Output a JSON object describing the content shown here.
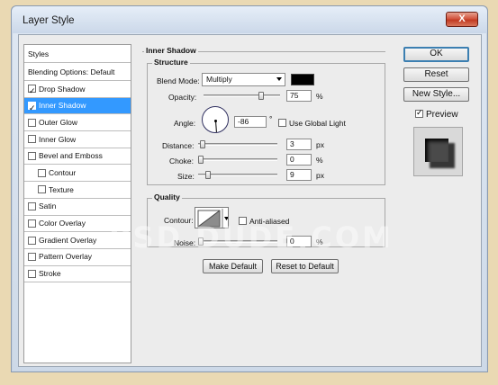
{
  "window": {
    "title": "Layer Style",
    "close_label": "X"
  },
  "styles_list": {
    "header": "Styles",
    "items": [
      {
        "label": "Blending Options: Default",
        "checkbox": false,
        "checked": false,
        "selected": false,
        "indent": false
      },
      {
        "label": "Drop Shadow",
        "checkbox": true,
        "checked": true,
        "selected": false,
        "indent": false
      },
      {
        "label": "Inner Shadow",
        "checkbox": true,
        "checked": true,
        "selected": true,
        "indent": false
      },
      {
        "label": "Outer Glow",
        "checkbox": true,
        "checked": false,
        "selected": false,
        "indent": false
      },
      {
        "label": "Inner Glow",
        "checkbox": true,
        "checked": false,
        "selected": false,
        "indent": false
      },
      {
        "label": "Bevel and Emboss",
        "checkbox": true,
        "checked": false,
        "selected": false,
        "indent": false
      },
      {
        "label": "Contour",
        "checkbox": true,
        "checked": false,
        "selected": false,
        "indent": true
      },
      {
        "label": "Texture",
        "checkbox": true,
        "checked": false,
        "selected": false,
        "indent": true
      },
      {
        "label": "Satin",
        "checkbox": true,
        "checked": false,
        "selected": false,
        "indent": false
      },
      {
        "label": "Color Overlay",
        "checkbox": true,
        "checked": false,
        "selected": false,
        "indent": false
      },
      {
        "label": "Gradient Overlay",
        "checkbox": true,
        "checked": false,
        "selected": false,
        "indent": false
      },
      {
        "label": "Pattern Overlay",
        "checkbox": true,
        "checked": false,
        "selected": false,
        "indent": false
      },
      {
        "label": "Stroke",
        "checkbox": true,
        "checked": false,
        "selected": false,
        "indent": false
      }
    ]
  },
  "inner_shadow": {
    "title": "Inner Shadow",
    "structure": {
      "title": "Structure",
      "blend_mode_label": "Blend Mode:",
      "blend_mode_value": "Multiply",
      "color": "#000000",
      "opacity_label": "Opacity:",
      "opacity_value": "75",
      "opacity_fraction": 0.75,
      "percent_unit": "%",
      "angle_label": "Angle:",
      "angle_value": "-86",
      "degree_unit": "°",
      "use_global_light_label": "Use Global Light",
      "use_global_light_checked": false,
      "distance_label": "Distance:",
      "distance_value": "3",
      "px_unit": "px",
      "choke_label": "Choke:",
      "choke_value": "0",
      "size_label": "Size:",
      "size_value": "9"
    },
    "quality": {
      "title": "Quality",
      "contour_label": "Contour:",
      "anti_aliased_label": "Anti-aliased",
      "anti_aliased_checked": false,
      "noise_label": "Noise:",
      "noise_value": "0"
    },
    "make_default_label": "Make Default",
    "reset_to_default_label": "Reset to Default"
  },
  "side_buttons": {
    "ok_label": "OK",
    "reset_label": "Reset",
    "new_style_label": "New Style...",
    "preview_label": "Preview",
    "preview_checked": true
  },
  "watermark": "PSD DUDE.COM",
  "colors": {
    "selection": "#3399ff",
    "dialog_bg": "#ececec",
    "page_bg": "#ead9b3"
  }
}
